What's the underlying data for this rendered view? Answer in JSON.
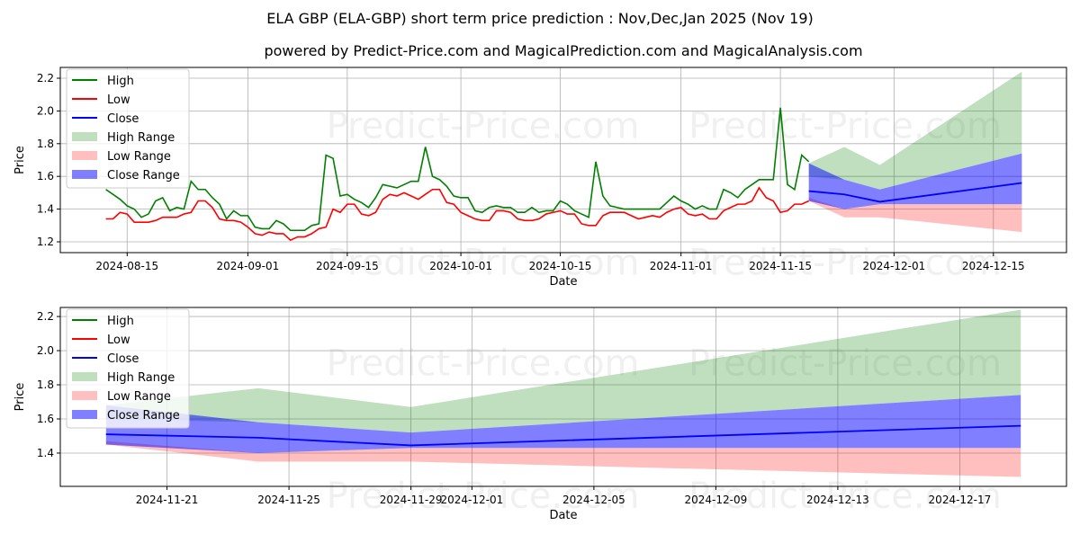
{
  "title": "ELA GBP (ELA-GBP) short term price prediction : Nov,Dec,Jan 2025 (Nov 19)",
  "subtitle": "powered by Predict-Price.com and MagicalPrediction.com and MagicalAnalysis.com",
  "watermark": "Predict-Price.com",
  "colors": {
    "high": "#008000",
    "low": "#ff0000",
    "close": "#0000ff",
    "high_range": "#008000",
    "low_range": "#ff0000",
    "close_range": "#0000ff"
  },
  "legend": [
    "High",
    "Low",
    "Close",
    "High Range",
    "Low Range",
    "Close Range"
  ],
  "history": {
    "start": "2024-08-12",
    "high": [
      1.52,
      1.49,
      1.46,
      1.42,
      1.4,
      1.35,
      1.37,
      1.45,
      1.47,
      1.39,
      1.41,
      1.4,
      1.57,
      1.52,
      1.52,
      1.47,
      1.43,
      1.34,
      1.39,
      1.36,
      1.36,
      1.29,
      1.28,
      1.28,
      1.33,
      1.31,
      1.27,
      1.27,
      1.27,
      1.3,
      1.31,
      1.73,
      1.71,
      1.48,
      1.49,
      1.46,
      1.44,
      1.41,
      1.47,
      1.55,
      1.54,
      1.53,
      1.55,
      1.57,
      1.57,
      1.78,
      1.6,
      1.58,
      1.54,
      1.48,
      1.47,
      1.47,
      1.39,
      1.38,
      1.41,
      1.42,
      1.41,
      1.41,
      1.38,
      1.38,
      1.41,
      1.38,
      1.39,
      1.39,
      1.45,
      1.43,
      1.39,
      1.37,
      1.35,
      1.69,
      1.48,
      1.42,
      1.41,
      1.4,
      1.4,
      1.4,
      1.4,
      1.4,
      1.4,
      1.44,
      1.48,
      1.45,
      1.43,
      1.4,
      1.42,
      1.4,
      1.4,
      1.52,
      1.5,
      1.47,
      1.52,
      1.55,
      1.58,
      1.58,
      1.58,
      2.02,
      1.55,
      1.52,
      1.73,
      1.69
    ],
    "low": [
      1.34,
      1.34,
      1.38,
      1.37,
      1.32,
      1.32,
      1.32,
      1.33,
      1.35,
      1.35,
      1.35,
      1.37,
      1.38,
      1.45,
      1.45,
      1.41,
      1.34,
      1.33,
      1.33,
      1.32,
      1.29,
      1.25,
      1.24,
      1.26,
      1.25,
      1.25,
      1.21,
      1.23,
      1.23,
      1.25,
      1.28,
      1.29,
      1.4,
      1.38,
      1.43,
      1.43,
      1.37,
      1.36,
      1.38,
      1.46,
      1.49,
      1.48,
      1.5,
      1.48,
      1.46,
      1.49,
      1.52,
      1.52,
      1.44,
      1.43,
      1.38,
      1.36,
      1.34,
      1.33,
      1.33,
      1.39,
      1.39,
      1.38,
      1.34,
      1.33,
      1.33,
      1.34,
      1.37,
      1.38,
      1.39,
      1.37,
      1.37,
      1.31,
      1.3,
      1.3,
      1.36,
      1.38,
      1.38,
      1.38,
      1.36,
      1.34,
      1.35,
      1.36,
      1.35,
      1.38,
      1.4,
      1.41,
      1.37,
      1.36,
      1.37,
      1.34,
      1.34,
      1.39,
      1.41,
      1.43,
      1.43,
      1.45,
      1.53,
      1.47,
      1.45,
      1.38,
      1.39,
      1.43,
      1.43,
      1.45
    ]
  },
  "forecast": {
    "dates": [
      "2024-11-19",
      "2024-11-24",
      "2024-11-29",
      "2024-12-19"
    ],
    "close": [
      1.51,
      1.49,
      1.445,
      1.56
    ],
    "high_range": {
      "upper": [
        1.68,
        1.78,
        1.67,
        2.24
      ],
      "lower": [
        1.6,
        1.58,
        1.52,
        1.74
      ]
    },
    "close_range": {
      "upper": [
        1.68,
        1.58,
        1.52,
        1.74
      ],
      "lower": [
        1.45,
        1.4,
        1.43,
        1.43
      ]
    },
    "low_range": {
      "upper": [
        1.47,
        1.4,
        1.43,
        1.43
      ],
      "lower": [
        1.45,
        1.35,
        1.35,
        1.26
      ]
    }
  },
  "chart_data": [
    {
      "type": "line",
      "xlabel": "Date",
      "ylabel": "Price",
      "xlim": [
        "2024-08-05T14:00",
        "2024-12-25T07:00"
      ],
      "ylim": [
        1.134,
        2.266
      ],
      "xticks": [
        "2024-08-15",
        "2024-09-01",
        "2024-09-15",
        "2024-10-01",
        "2024-10-15",
        "2024-11-01",
        "2024-11-15",
        "2024-12-01",
        "2024-12-15"
      ],
      "yticks": [
        "1.2",
        "1.4",
        "1.6",
        "1.8",
        "2.0",
        "2.2"
      ],
      "grid": true,
      "legend": "top-left",
      "show_history": true
    },
    {
      "type": "line",
      "xlabel": "Date",
      "ylabel": "Price",
      "xlim": [
        "2024-11-17T12:00",
        "2024-12-20T12:00"
      ],
      "ylim": [
        1.205,
        2.253
      ],
      "xticks": [
        "2024-11-21",
        "2024-11-25",
        "2024-11-29",
        "2024-12-01",
        "2024-12-05",
        "2024-12-09",
        "2024-12-13",
        "2024-12-17"
      ],
      "yticks": [
        "1.4",
        "1.6",
        "1.8",
        "2.0",
        "2.2"
      ],
      "grid": true,
      "legend": "top-left",
      "show_history": false
    }
  ]
}
